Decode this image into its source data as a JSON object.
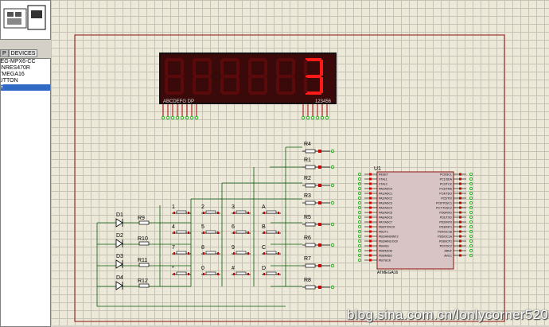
{
  "left_panel": {
    "tabs": [
      "P",
      "DEVICES"
    ],
    "devices": [
      "7SEG-MPX6-CC",
      "MINRES470R",
      "ATMEGA16",
      "BUTTON",
      "DIODE"
    ],
    "selected_index": 4
  },
  "display": {
    "digits": [
      "8",
      "8",
      "8",
      "8",
      "8",
      "3"
    ],
    "seg_pins_label": "ABCDEFG DP",
    "digit_pins_label": "123456",
    "segment_color": "#ff1a1a",
    "dim_color": "#5a0a0a"
  },
  "keypad": {
    "buttons": [
      "1",
      "2",
      "3",
      "A",
      "4",
      "5",
      "6",
      "B",
      "7",
      "8",
      "9",
      "C",
      "*",
      "0",
      "#",
      "D"
    ]
  },
  "resistors": {
    "right": [
      "R4",
      "R1",
      "R2",
      "R3",
      "R5",
      "R6",
      "R7",
      "R8"
    ],
    "left": [
      "R9",
      "R10",
      "R11",
      "R12"
    ]
  },
  "diodes": [
    "D1",
    "D2",
    "D3",
    "D4"
  ],
  "mcu": {
    "label": "U1",
    "left_pins": [
      "RESET",
      "XTAL1",
      "XTAL2",
      "PA0/ADC0",
      "PA1/ADC1",
      "PA2/ADC2",
      "PA3/ADC3",
      "PA4/ADC4",
      "PA5/ADC5",
      "PA6/ADC6",
      "PA7/ADC7",
      "PB0/T0/XCK",
      "PB1/T1",
      "PB2/AIN0/INT2",
      "PB3/AIN1/OC0",
      "PB4/SS",
      "PB5/MOSI",
      "PB6/MISO",
      "PB7/SCK"
    ],
    "right_pins": [
      "PC0/SCL",
      "PC1/SDA",
      "PC2/TCK",
      "PC3/TMS",
      "PC4/TDO",
      "PC5/TDI",
      "PC6/TOSC1",
      "PC7/TOSC2",
      "PD0/RXD",
      "PD1/TXD",
      "PD2/INT0",
      "PD3/INT1",
      "PD4/OC1B",
      "PD5/OC1A",
      "PD6/ICP1",
      "PD7/OC2",
      "AREF",
      "AVCC"
    ],
    "part": "ATMEGA16"
  },
  "watermark": "blog.sina.com.cn/lonlycorner520"
}
